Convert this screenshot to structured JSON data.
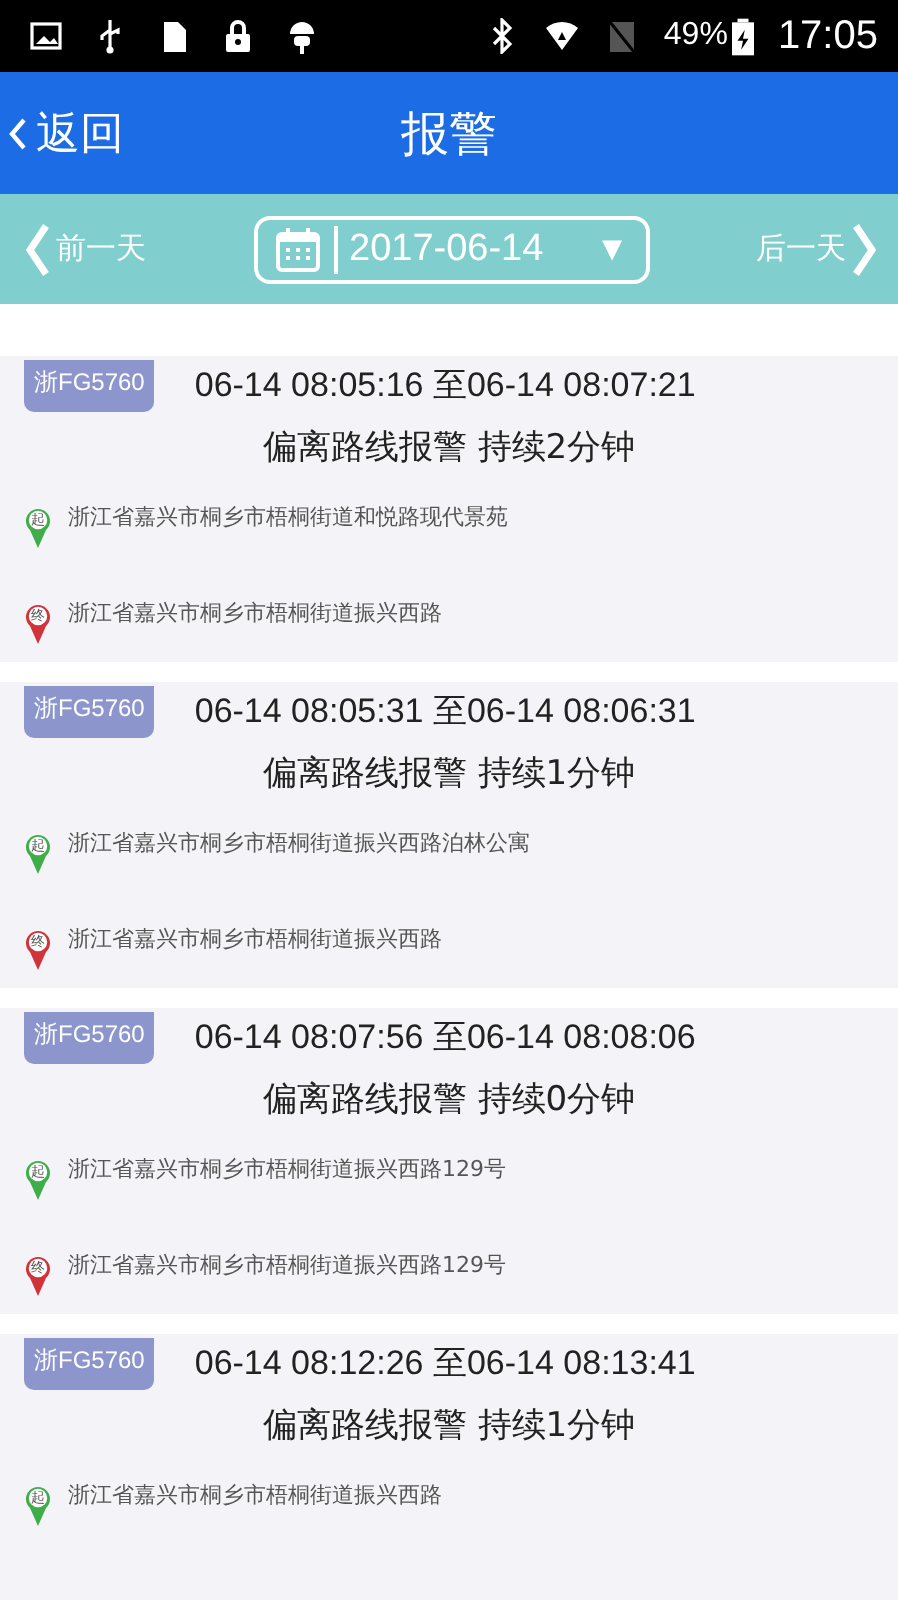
{
  "status_bar": {
    "battery": "49%",
    "time": "17:05"
  },
  "header": {
    "back": "返回",
    "title": "报警"
  },
  "date_bar": {
    "prev": "前一天",
    "date": "2017-06-14",
    "dropdown": "▼",
    "next": "后一天"
  },
  "alarms": [
    {
      "plate": "浙FG5760",
      "period": "06-14 08:05:16 至06-14 08:07:21",
      "summary": "偏离路线报警 持续2分钟",
      "start_pin": "起",
      "start": "浙江省嘉兴市桐乡市梧桐街道和悦路现代景苑",
      "end_pin": "终",
      "end": "浙江省嘉兴市桐乡市梧桐街道振兴西路"
    },
    {
      "plate": "浙FG5760",
      "period": "06-14 08:05:31 至06-14 08:06:31",
      "summary": "偏离路线报警 持续1分钟",
      "start_pin": "起",
      "start": "浙江省嘉兴市桐乡市梧桐街道振兴西路泊林公寓",
      "end_pin": "终",
      "end": "浙江省嘉兴市桐乡市梧桐街道振兴西路"
    },
    {
      "plate": "浙FG5760",
      "period": "06-14 08:07:56 至06-14 08:08:06",
      "summary": "偏离路线报警 持续0分钟",
      "start_pin": "起",
      "start": "浙江省嘉兴市桐乡市梧桐街道振兴西路129号",
      "end_pin": "终",
      "end": "浙江省嘉兴市桐乡市梧桐街道振兴西路129号"
    },
    {
      "plate": "浙FG5760",
      "period": "06-14 08:12:26 至06-14 08:13:41",
      "summary": "偏离路线报警 持续1分钟",
      "start_pin": "起",
      "start": "浙江省嘉兴市桐乡市梧桐街道振兴西路"
    }
  ]
}
